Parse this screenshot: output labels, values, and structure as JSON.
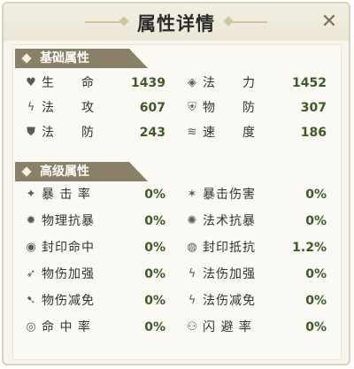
{
  "window": {
    "title": "属性详情",
    "close_icon": "close-icon"
  },
  "basic": {
    "heading": "基础属性",
    "rows": [
      [
        {
          "icon": "heart-icon",
          "glyph": "♥",
          "label": "生　　命",
          "value": "1439"
        },
        {
          "icon": "magic-power-icon",
          "glyph": "◈",
          "label": "法　　力",
          "value": "1452"
        }
      ],
      [
        {
          "icon": "magic-attack-icon",
          "glyph": "ϟ",
          "label": "法　　攻",
          "value": "607"
        },
        {
          "icon": "physical-defense-icon",
          "glyph": "⛨",
          "label": "物　　防",
          "value": "307"
        }
      ],
      [
        {
          "icon": "magic-defense-icon",
          "glyph": "⛊",
          "label": "法　　防",
          "value": "243"
        },
        {
          "icon": "speed-icon",
          "glyph": "≋",
          "label": "速　　度",
          "value": "186"
        }
      ]
    ]
  },
  "advanced": {
    "heading": "高级属性",
    "rows": [
      [
        {
          "icon": "critical-rate-icon",
          "glyph": "✦",
          "label": "暴 击 率",
          "value": "0%"
        },
        {
          "icon": "critical-damage-icon",
          "glyph": "✶",
          "label": "暴击伤害",
          "value": "0%"
        }
      ],
      [
        {
          "icon": "physical-crit-resist-icon",
          "glyph": "✹",
          "label": "物理抗暴",
          "value": "0%"
        },
        {
          "icon": "magic-crit-resist-icon",
          "glyph": "✺",
          "label": "法术抗暴",
          "value": "0%"
        }
      ],
      [
        {
          "icon": "seal-hit-icon",
          "glyph": "◉",
          "label": "封印命中",
          "value": "0%"
        },
        {
          "icon": "seal-resist-icon",
          "glyph": "◍",
          "label": "封印抵抗",
          "value": "1.2%"
        }
      ],
      [
        {
          "icon": "physical-damage-boost-icon",
          "glyph": "➶",
          "label": "物伤加强",
          "value": "0%"
        },
        {
          "icon": "magic-damage-boost-icon",
          "glyph": "ϟ",
          "label": "法伤加强",
          "value": "0%"
        }
      ],
      [
        {
          "icon": "physical-damage-reduction-icon",
          "glyph": "➷",
          "label": "物伤减免",
          "value": "0%"
        },
        {
          "icon": "magic-damage-reduction-icon",
          "glyph": "ϟ",
          "label": "法伤减免",
          "value": "0%"
        }
      ],
      [
        {
          "icon": "hit-rate-icon",
          "glyph": "◎",
          "label": "命 中 率",
          "value": "0%"
        },
        {
          "icon": "dodge-rate-icon",
          "glyph": "⚇",
          "label": "闪 避 率",
          "value": "0%"
        }
      ]
    ]
  }
}
